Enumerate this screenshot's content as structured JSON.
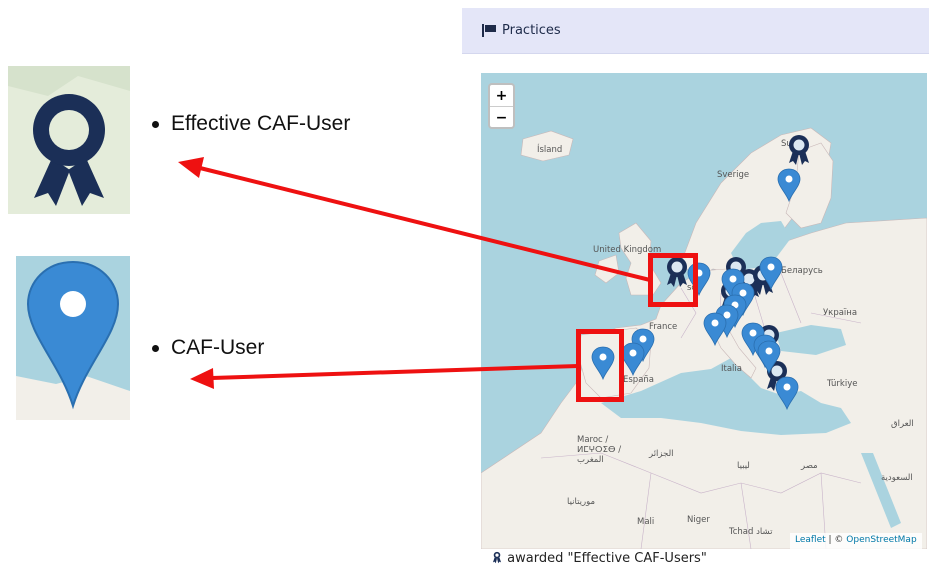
{
  "panel": {
    "title": "Practices"
  },
  "map": {
    "zoom_in": "+",
    "zoom_out": "−",
    "attribution_leaflet": "Leaflet",
    "attribution_sep": " | © ",
    "attribution_osm": "OpenStreetMap",
    "labels": {
      "island": "Ísland",
      "sverige": "Sverige",
      "suomi": "Suomi",
      "uk": "United Kingdom",
      "belarus": "Беларусь",
      "ukraina": "Україна",
      "france": "France",
      "espana": "España",
      "italia": "Italia",
      "turkiye": "Türkiye",
      "iraq": "العراق",
      "maroc": "Maroc / ⵍⵎⵖⵔⵉⴱ / المغرب",
      "algeria": "الجزائر",
      "libya": "ليبيا",
      "egypt": "مصر",
      "saudi": "السعودية",
      "mauritania": "موريتانيا",
      "mali": "Mali",
      "niger": "Niger",
      "chad": "Tchad تشاد",
      "deutschland": "sch"
    }
  },
  "legend": {
    "text": "awarded \"Effective CAF-Users\""
  },
  "annotations": {
    "effective_label": "Effective CAF-User",
    "caf_label": "CAF-User"
  },
  "colors": {
    "award": "#1b2f57",
    "pin": "#3a8ad4",
    "arrow": "#ee1111",
    "sea": "#aad3df",
    "land": "#f2efe9"
  }
}
